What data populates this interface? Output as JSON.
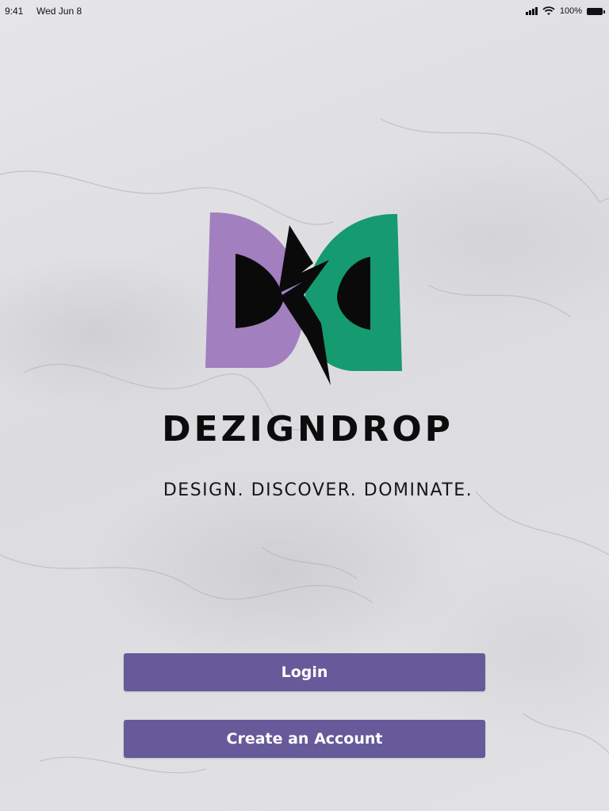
{
  "status_bar": {
    "time": "9:41",
    "date": "Wed Jun 8",
    "battery": "100%",
    "icons": [
      "signal-icon",
      "wifi-icon",
      "battery-icon"
    ]
  },
  "brand": {
    "name": "DEZIGNDROP",
    "tagline": "DESIGN. DISCOVER. DOMINATE.",
    "logo_colors": {
      "left": "#a27fbe",
      "right": "#169a70",
      "bolt": "#0a0a0a"
    }
  },
  "actions": {
    "login_label": "Login",
    "create_account_label": "Create an Account",
    "button_color": "#665a9a"
  }
}
